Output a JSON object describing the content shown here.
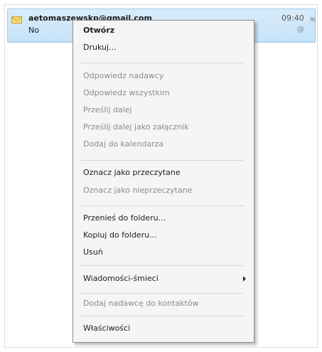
{
  "message": {
    "sender": "aetomaszewskp@gmail.com",
    "subject": "No",
    "time": "09:40"
  },
  "icons": {
    "envelope": "envelope-icon",
    "attachment": "paperclip-icon",
    "flag": "flag-icon",
    "submenu": "chevron-right-icon"
  },
  "menu": {
    "items": [
      {
        "label": "Otwórz",
        "enabled": true,
        "bold": true
      },
      {
        "label": "Drukuj...",
        "enabled": true
      },
      {
        "label": "Odpowiedz nadawcy",
        "enabled": false
      },
      {
        "label": "Odpowiedz wszystkim",
        "enabled": false
      },
      {
        "label": "Prześlij dalej",
        "enabled": false
      },
      {
        "label": "Prześlij dalej jako załącznik",
        "enabled": false
      },
      {
        "label": "Dodaj do kalendarza",
        "enabled": false
      },
      {
        "label": "Oznacz jako przeczytane",
        "enabled": true
      },
      {
        "label": "Oznacz jako nieprzeczytane",
        "enabled": false
      },
      {
        "label": "Przenieś do folderu...",
        "enabled": true
      },
      {
        "label": "Kopiuj do folderu...",
        "enabled": true
      },
      {
        "label": "Usuń",
        "enabled": true
      },
      {
        "label": "Wiadomości-śmieci",
        "enabled": true,
        "submenu": true
      },
      {
        "label": "Dodaj nadawcę do kontaktów",
        "enabled": false
      },
      {
        "label": "Właściwości",
        "enabled": true
      }
    ]
  },
  "colors": {
    "selection_bg": "#c5e2f8",
    "menu_bg": "#f5f5f5",
    "enabled_text": "#1e1e1e",
    "disabled_text": "#8b8b8b"
  }
}
